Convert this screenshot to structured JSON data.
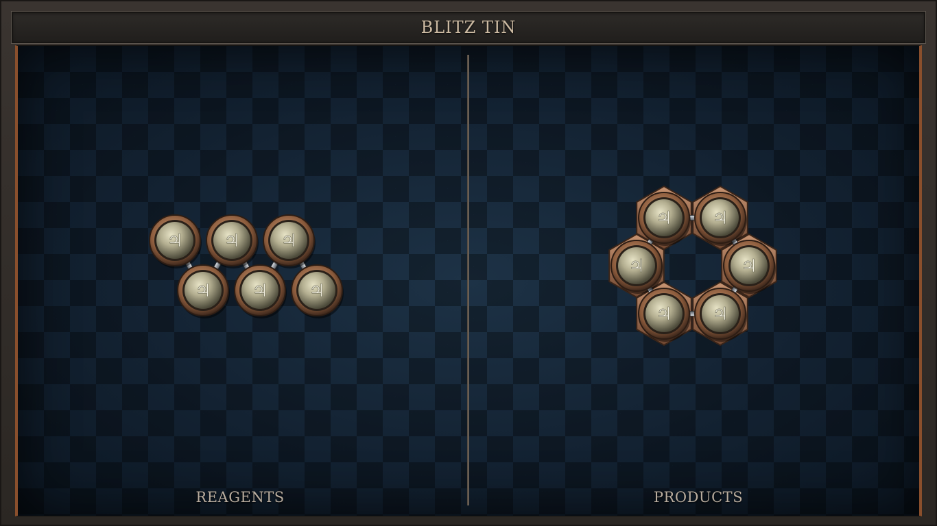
{
  "header": {
    "title": "BLITZ TIN"
  },
  "panels": {
    "reagents": {
      "label": "REAGENTS"
    },
    "products": {
      "label": "PRODUCTS"
    }
  },
  "atom_symbol": "♃",
  "atom_element": "tin",
  "colors": {
    "board": "#142231",
    "rim": "#a36f4f",
    "orb": "#b9b69a",
    "glyph": "#f2efe0",
    "bond": "#b8bcc2",
    "accent_edge": "#8a4f2c"
  },
  "reagents": {
    "atoms": [
      "tin",
      "tin",
      "tin",
      "tin",
      "tin",
      "tin"
    ],
    "bond_count": 5
  },
  "products": {
    "atoms": [
      "tin",
      "tin",
      "tin",
      "tin",
      "tin",
      "tin"
    ],
    "bond_count": 6
  }
}
